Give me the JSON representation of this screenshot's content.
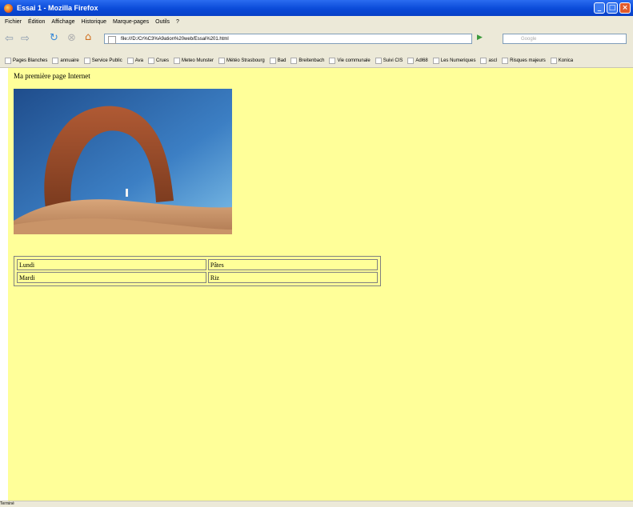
{
  "window": {
    "title": "Essai 1 - Mozilla Firefox"
  },
  "menu": [
    "Fichier",
    "Édition",
    "Affichage",
    "Historique",
    "Marque-pages",
    "Outils",
    "?"
  ],
  "nav": {
    "url": "file:///D:/Cr%C3%A9ation%20web/Essai%201.html",
    "search_placeholder": "Google"
  },
  "bookmarks": [
    "Pages Blanches",
    "annuaire",
    "Service Public",
    "Ava",
    "Crues",
    "Meteo Munster",
    "Météo Strasbourg",
    "Bad",
    "Breitenbach",
    "Vie communale",
    "Suivi CIS",
    "Adl68",
    "Les Numeriques",
    "ascl",
    "Risques majeurs",
    "Konica"
  ],
  "page": {
    "heading": "Ma première page Internet",
    "table": [
      [
        "Lundi",
        "Pâtes"
      ],
      [
        "Mardi",
        "Riz"
      ]
    ]
  },
  "status": "Terminé",
  "colors": {
    "page_bg": "#ffff99",
    "titlebar": "#0a4ad8"
  }
}
